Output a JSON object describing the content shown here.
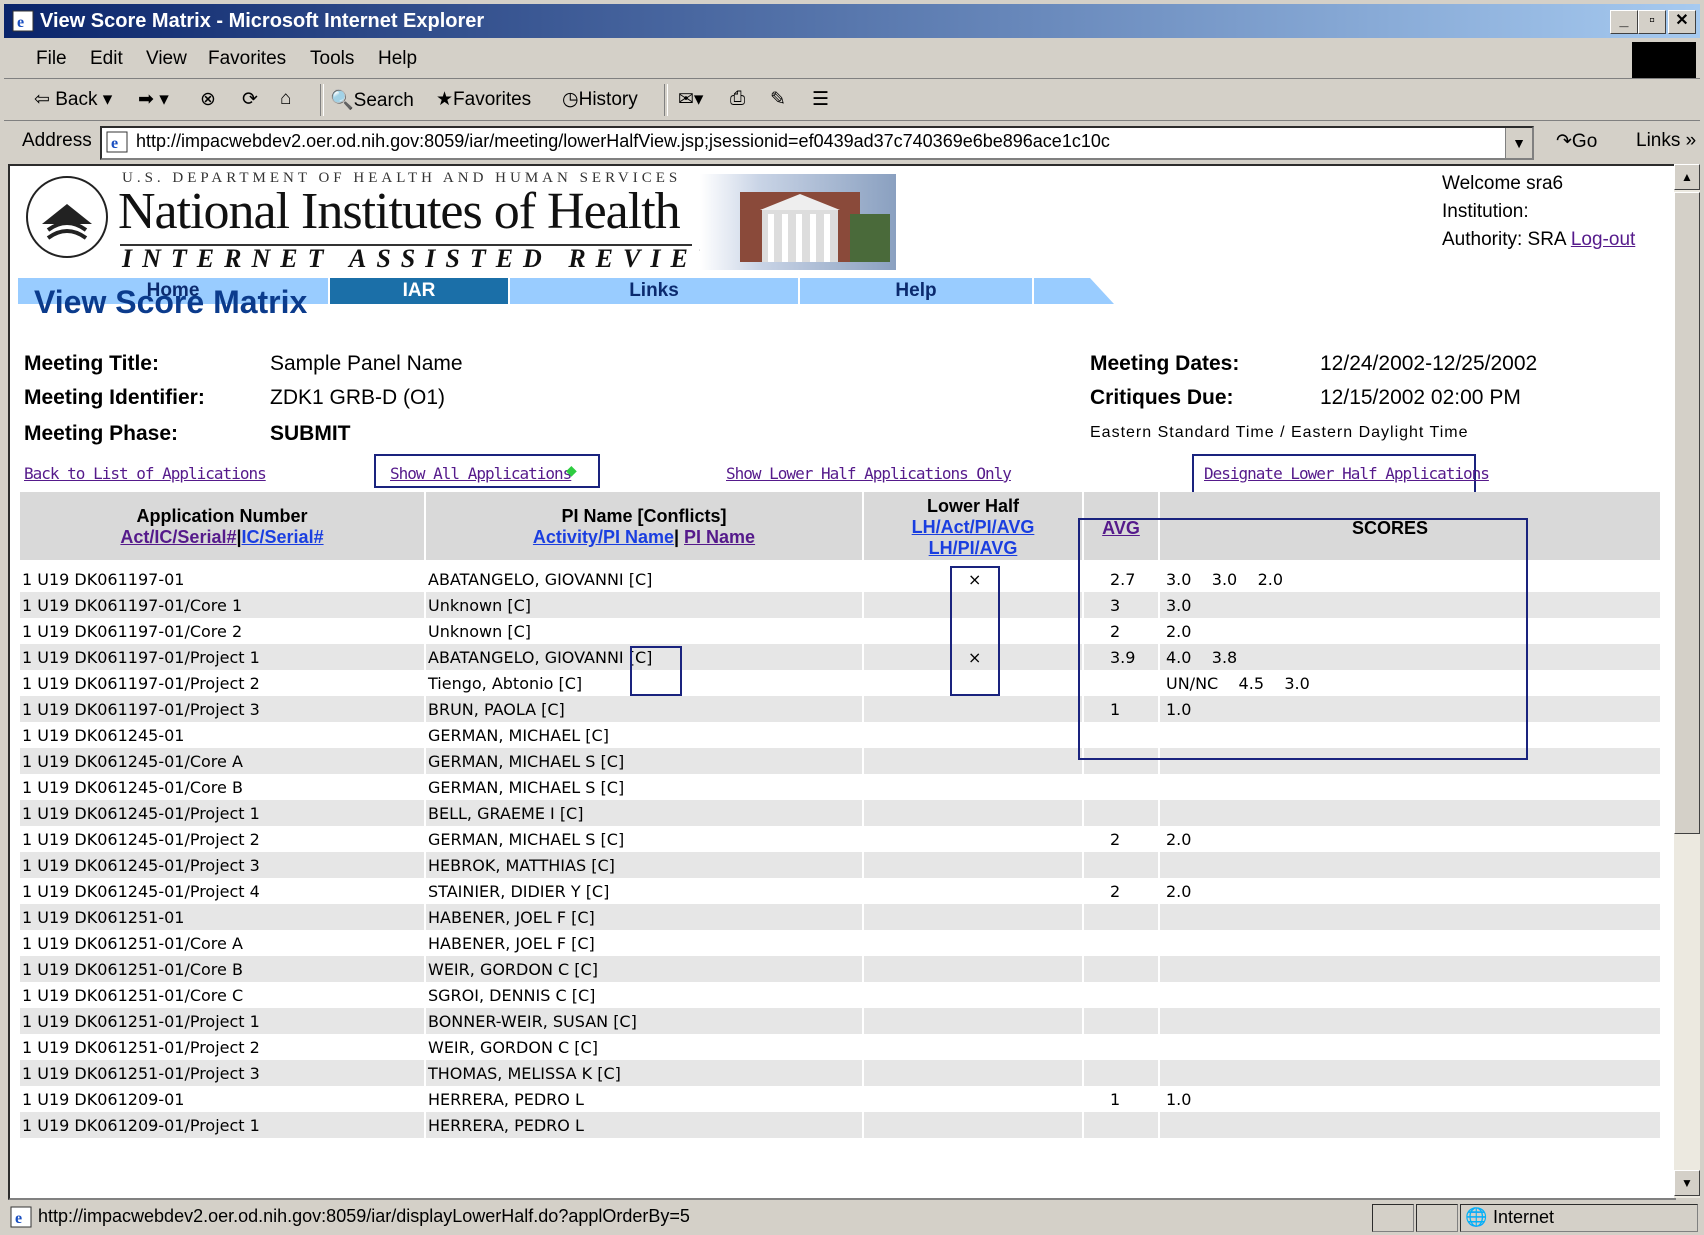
{
  "window": {
    "title": "View Score Matrix - Microsoft Internet Explorer"
  },
  "menu": [
    "File",
    "Edit",
    "View",
    "Favorites",
    "Tools",
    "Help"
  ],
  "toolbar": {
    "back": "Back",
    "search": "Search",
    "favorites": "Favorites",
    "history": "History"
  },
  "address": {
    "label": "Address",
    "url": "http://impacwebdev2.oer.od.nih.gov:8059/iar/meeting/lowerHalfView.jsp;jsessionid=ef0439ad37c740369e6be896ace1c10c",
    "go": "Go",
    "links": "Links"
  },
  "status": {
    "text": "http://impacwebdev2.oer.od.nih.gov:8059/iar/displayLowerHalf.do?applOrderBy=5",
    "zone": "Internet"
  },
  "header": {
    "dept": "U.S. DEPARTMENT OF HEALTH AND HUMAN SERVICES",
    "name": "National Institutes of Health",
    "tagline": "INTERNET ASSISTED REVIEW",
    "welcome": "Welcome  sra6",
    "institution": "Institution:",
    "authority": "Authority:   SRA",
    "logout": "Log-out"
  },
  "nav": [
    "Home",
    "IAR",
    "Links",
    "Help"
  ],
  "page": {
    "title": "View Score Matrix",
    "meeting_title_label": "Meeting Title:",
    "meeting_title": "Sample Panel Name",
    "meeting_id_label": "Meeting Identifier:",
    "meeting_id": "ZDK1 GRB-D (O1)",
    "meeting_phase_label": "Meeting Phase:",
    "meeting_phase": "SUBMIT",
    "meeting_dates_label": "Meeting Dates:",
    "meeting_dates": "12/24/2002-12/25/2002",
    "critiques_label": "Critiques Due:",
    "critiques_due": "12/15/2002 02:00 PM",
    "tz": "Eastern Standard Time / Eastern Daylight Time"
  },
  "links": {
    "back": "Back to List of Applications",
    "show_all": "Show All Applications",
    "show_lower": "Show Lower Half Applications Only",
    "designate": "Designate Lower Half Applications"
  },
  "table": {
    "h_app": "Application Number",
    "h_app_sort1": "Act/IC/Serial#",
    "h_app_sort2": "IC/Serial#",
    "h_pi": "PI Name [Conflicts]",
    "h_pi_sort1": "Activity/PI Name",
    "h_pi_sort2": "PI Name",
    "h_lh": "Lower Half",
    "h_lh_sort1": "LH/Act/PI/AVG",
    "h_lh_sort2": "LH/PI/AVG",
    "h_avg": "AVG",
    "h_scores": "SCORES",
    "rows": [
      {
        "app": "1 U19 DK061197-01",
        "pi": "ABATANGELO, GIOVANNI [C]",
        "lh": "×",
        "avg": "2.7",
        "scores": "3.0    3.0    2.0"
      },
      {
        "app": "1 U19 DK061197-01/Core 1",
        "pi": "Unknown [C]",
        "lh": "",
        "avg": "3",
        "scores": "3.0"
      },
      {
        "app": "1 U19 DK061197-01/Core 2",
        "pi": "Unknown [C]",
        "lh": "",
        "avg": "2",
        "scores": "2.0"
      },
      {
        "app": "1 U19 DK061197-01/Project 1",
        "pi": "ABATANGELO, GIOVANNI [C]",
        "lh": "×",
        "avg": "3.9",
        "scores": "4.0    3.8"
      },
      {
        "app": "1 U19 DK061197-01/Project 2",
        "pi": "Tiengo, Abtonio [C]",
        "lh": "",
        "avg": "",
        "scores": "UN/NC    4.5    3.0"
      },
      {
        "app": "1 U19 DK061197-01/Project 3",
        "pi": "BRUN, PAOLA [C]",
        "lh": "",
        "avg": "1",
        "scores": "1.0"
      },
      {
        "app": "1 U19 DK061245-01",
        "pi": "GERMAN, MICHAEL [C]",
        "lh": "",
        "avg": "",
        "scores": ""
      },
      {
        "app": "1 U19 DK061245-01/Core A",
        "pi": "GERMAN, MICHAEL S [C]",
        "lh": "",
        "avg": "",
        "scores": ""
      },
      {
        "app": "1 U19 DK061245-01/Core B",
        "pi": "GERMAN, MICHAEL S [C]",
        "lh": "",
        "avg": "",
        "scores": ""
      },
      {
        "app": "1 U19 DK061245-01/Project 1",
        "pi": "BELL, GRAEME I [C]",
        "lh": "",
        "avg": "",
        "scores": ""
      },
      {
        "app": "1 U19 DK061245-01/Project 2",
        "pi": "GERMAN, MICHAEL S [C]",
        "lh": "",
        "avg": "2",
        "scores": "2.0"
      },
      {
        "app": "1 U19 DK061245-01/Project 3",
        "pi": "HEBROK, MATTHIAS [C]",
        "lh": "",
        "avg": "",
        "scores": ""
      },
      {
        "app": "1 U19 DK061245-01/Project 4",
        "pi": "STAINIER, DIDIER Y [C]",
        "lh": "",
        "avg": "2",
        "scores": "2.0"
      },
      {
        "app": "1 U19 DK061251-01",
        "pi": "HABENER, JOEL F [C]",
        "lh": "",
        "avg": "",
        "scores": ""
      },
      {
        "app": "1 U19 DK061251-01/Core A",
        "pi": "HABENER, JOEL F [C]",
        "lh": "",
        "avg": "",
        "scores": ""
      },
      {
        "app": "1 U19 DK061251-01/Core B",
        "pi": "WEIR, GORDON C [C]",
        "lh": "",
        "avg": "",
        "scores": ""
      },
      {
        "app": "1 U19 DK061251-01/Core C",
        "pi": "SGROI, DENNIS C [C]",
        "lh": "",
        "avg": "",
        "scores": ""
      },
      {
        "app": "1 U19 DK061251-01/Project 1",
        "pi": "BONNER-WEIR, SUSAN [C]",
        "lh": "",
        "avg": "",
        "scores": ""
      },
      {
        "app": "1 U19 DK061251-01/Project 2",
        "pi": "WEIR, GORDON C [C]",
        "lh": "",
        "avg": "",
        "scores": ""
      },
      {
        "app": "1 U19 DK061251-01/Project 3",
        "pi": "THOMAS, MELISSA K [C]",
        "lh": "",
        "avg": "",
        "scores": ""
      },
      {
        "app": "1 U19 DK061209-01",
        "pi": "HERRERA, PEDRO L",
        "lh": "",
        "avg": "1",
        "scores": "1.0"
      },
      {
        "app": "1 U19 DK061209-01/Project 1",
        "pi": "HERRERA, PEDRO L",
        "lh": "",
        "avg": "",
        "scores": ""
      }
    ]
  },
  "colors": {
    "link_visited": "#551a8b",
    "link": "#1a3ee0",
    "nav_active": "#1b6fa8",
    "nav": "#99ccff",
    "title": "#0b3b8c"
  }
}
